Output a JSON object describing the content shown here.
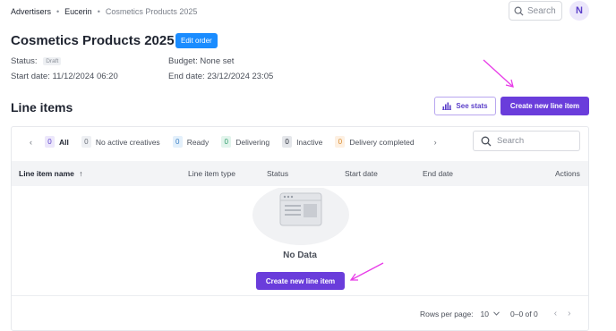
{
  "breadcrumb": {
    "items": [
      "Advertisers",
      "Eucerin",
      "Cosmetics Products 2025"
    ],
    "separator": "•"
  },
  "header": {
    "search_placeholder": "Search",
    "avatar_initial": "N"
  },
  "order": {
    "title": "Cosmetics Products 2025",
    "edit_label": "Edit order",
    "status_label": "Status:",
    "status_value": "Draft",
    "budget_label": "Budget:",
    "budget_value": "None set",
    "start_label": "Start date:",
    "start_value": "11/12/2024 06:20",
    "end_label": "End date:",
    "end_value": "23/12/2024 23:05"
  },
  "line_items": {
    "title": "Line items",
    "see_stats_label": "See stats",
    "create_label": "Create new line item",
    "tabs": [
      {
        "count": "0",
        "label": "All",
        "count_bg": "#ece7fb",
        "count_color": "#5b3fc9"
      },
      {
        "count": "0",
        "label": "No active creatives",
        "count_bg": "#eef0f3",
        "count_color": "#6a6f79"
      },
      {
        "count": "0",
        "label": "Ready",
        "count_bg": "#e3f0fb",
        "count_color": "#3b7fc4"
      },
      {
        "count": "0",
        "label": "Delivering",
        "count_bg": "#e2f4ec",
        "count_color": "#2f9d6a"
      },
      {
        "count": "0",
        "label": "Inactive",
        "count_bg": "#e4e6ea",
        "count_color": "#1f2430"
      },
      {
        "count": "0",
        "label": "Delivery completed",
        "count_bg": "#fdf0e2",
        "count_color": "#d98a2b"
      }
    ],
    "search_placeholder": "Search",
    "columns": [
      "Line item name",
      "Line item type",
      "Status",
      "Start date",
      "End date",
      "Actions"
    ],
    "empty_text": "No Data",
    "empty_create_label": "Create new line item",
    "pagination": {
      "rows_label": "Rows per page:",
      "rows_value": "10",
      "range": "0–0 of 0"
    }
  },
  "colors": {
    "accent": "#6a3ddb",
    "edit_button": "#1a8cff",
    "annotation_arrow": "#e83ce8"
  }
}
